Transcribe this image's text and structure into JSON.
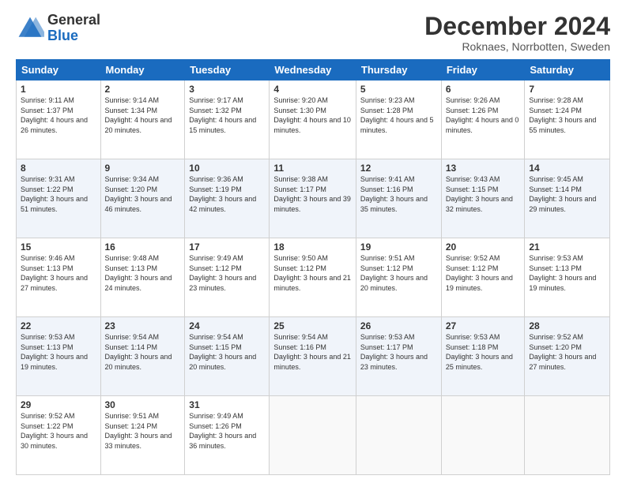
{
  "logo": {
    "line1": "General",
    "line2": "Blue"
  },
  "title": "December 2024",
  "subtitle": "Roknaes, Norrbotten, Sweden",
  "header_days": [
    "Sunday",
    "Monday",
    "Tuesday",
    "Wednesday",
    "Thursday",
    "Friday",
    "Saturday"
  ],
  "weeks": [
    [
      {
        "day": "1",
        "sunrise": "Sunrise: 9:11 AM",
        "sunset": "Sunset: 1:37 PM",
        "daylight": "Daylight: 4 hours and 26 minutes."
      },
      {
        "day": "2",
        "sunrise": "Sunrise: 9:14 AM",
        "sunset": "Sunset: 1:34 PM",
        "daylight": "Daylight: 4 hours and 20 minutes."
      },
      {
        "day": "3",
        "sunrise": "Sunrise: 9:17 AM",
        "sunset": "Sunset: 1:32 PM",
        "daylight": "Daylight: 4 hours and 15 minutes."
      },
      {
        "day": "4",
        "sunrise": "Sunrise: 9:20 AM",
        "sunset": "Sunset: 1:30 PM",
        "daylight": "Daylight: 4 hours and 10 minutes."
      },
      {
        "day": "5",
        "sunrise": "Sunrise: 9:23 AM",
        "sunset": "Sunset: 1:28 PM",
        "daylight": "Daylight: 4 hours and 5 minutes."
      },
      {
        "day": "6",
        "sunrise": "Sunrise: 9:26 AM",
        "sunset": "Sunset: 1:26 PM",
        "daylight": "Daylight: 4 hours and 0 minutes."
      },
      {
        "day": "7",
        "sunrise": "Sunrise: 9:28 AM",
        "sunset": "Sunset: 1:24 PM",
        "daylight": "Daylight: 3 hours and 55 minutes."
      }
    ],
    [
      {
        "day": "8",
        "sunrise": "Sunrise: 9:31 AM",
        "sunset": "Sunset: 1:22 PM",
        "daylight": "Daylight: 3 hours and 51 minutes."
      },
      {
        "day": "9",
        "sunrise": "Sunrise: 9:34 AM",
        "sunset": "Sunset: 1:20 PM",
        "daylight": "Daylight: 3 hours and 46 minutes."
      },
      {
        "day": "10",
        "sunrise": "Sunrise: 9:36 AM",
        "sunset": "Sunset: 1:19 PM",
        "daylight": "Daylight: 3 hours and 42 minutes."
      },
      {
        "day": "11",
        "sunrise": "Sunrise: 9:38 AM",
        "sunset": "Sunset: 1:17 PM",
        "daylight": "Daylight: 3 hours and 39 minutes."
      },
      {
        "day": "12",
        "sunrise": "Sunrise: 9:41 AM",
        "sunset": "Sunset: 1:16 PM",
        "daylight": "Daylight: 3 hours and 35 minutes."
      },
      {
        "day": "13",
        "sunrise": "Sunrise: 9:43 AM",
        "sunset": "Sunset: 1:15 PM",
        "daylight": "Daylight: 3 hours and 32 minutes."
      },
      {
        "day": "14",
        "sunrise": "Sunrise: 9:45 AM",
        "sunset": "Sunset: 1:14 PM",
        "daylight": "Daylight: 3 hours and 29 minutes."
      }
    ],
    [
      {
        "day": "15",
        "sunrise": "Sunrise: 9:46 AM",
        "sunset": "Sunset: 1:13 PM",
        "daylight": "Daylight: 3 hours and 27 minutes."
      },
      {
        "day": "16",
        "sunrise": "Sunrise: 9:48 AM",
        "sunset": "Sunset: 1:13 PM",
        "daylight": "Daylight: 3 hours and 24 minutes."
      },
      {
        "day": "17",
        "sunrise": "Sunrise: 9:49 AM",
        "sunset": "Sunset: 1:12 PM",
        "daylight": "Daylight: 3 hours and 23 minutes."
      },
      {
        "day": "18",
        "sunrise": "Sunrise: 9:50 AM",
        "sunset": "Sunset: 1:12 PM",
        "daylight": "Daylight: 3 hours and 21 minutes."
      },
      {
        "day": "19",
        "sunrise": "Sunrise: 9:51 AM",
        "sunset": "Sunset: 1:12 PM",
        "daylight": "Daylight: 3 hours and 20 minutes."
      },
      {
        "day": "20",
        "sunrise": "Sunrise: 9:52 AM",
        "sunset": "Sunset: 1:12 PM",
        "daylight": "Daylight: 3 hours and 19 minutes."
      },
      {
        "day": "21",
        "sunrise": "Sunrise: 9:53 AM",
        "sunset": "Sunset: 1:13 PM",
        "daylight": "Daylight: 3 hours and 19 minutes."
      }
    ],
    [
      {
        "day": "22",
        "sunrise": "Sunrise: 9:53 AM",
        "sunset": "Sunset: 1:13 PM",
        "daylight": "Daylight: 3 hours and 19 minutes."
      },
      {
        "day": "23",
        "sunrise": "Sunrise: 9:54 AM",
        "sunset": "Sunset: 1:14 PM",
        "daylight": "Daylight: 3 hours and 20 minutes."
      },
      {
        "day": "24",
        "sunrise": "Sunrise: 9:54 AM",
        "sunset": "Sunset: 1:15 PM",
        "daylight": "Daylight: 3 hours and 20 minutes."
      },
      {
        "day": "25",
        "sunrise": "Sunrise: 9:54 AM",
        "sunset": "Sunset: 1:16 PM",
        "daylight": "Daylight: 3 hours and 21 minutes."
      },
      {
        "day": "26",
        "sunrise": "Sunrise: 9:53 AM",
        "sunset": "Sunset: 1:17 PM",
        "daylight": "Daylight: 3 hours and 23 minutes."
      },
      {
        "day": "27",
        "sunrise": "Sunrise: 9:53 AM",
        "sunset": "Sunset: 1:18 PM",
        "daylight": "Daylight: 3 hours and 25 minutes."
      },
      {
        "day": "28",
        "sunrise": "Sunrise: 9:52 AM",
        "sunset": "Sunset: 1:20 PM",
        "daylight": "Daylight: 3 hours and 27 minutes."
      }
    ],
    [
      {
        "day": "29",
        "sunrise": "Sunrise: 9:52 AM",
        "sunset": "Sunset: 1:22 PM",
        "daylight": "Daylight: 3 hours and 30 minutes."
      },
      {
        "day": "30",
        "sunrise": "Sunrise: 9:51 AM",
        "sunset": "Sunset: 1:24 PM",
        "daylight": "Daylight: 3 hours and 33 minutes."
      },
      {
        "day": "31",
        "sunrise": "Sunrise: 9:49 AM",
        "sunset": "Sunset: 1:26 PM",
        "daylight": "Daylight: 3 hours and 36 minutes."
      },
      null,
      null,
      null,
      null
    ]
  ]
}
